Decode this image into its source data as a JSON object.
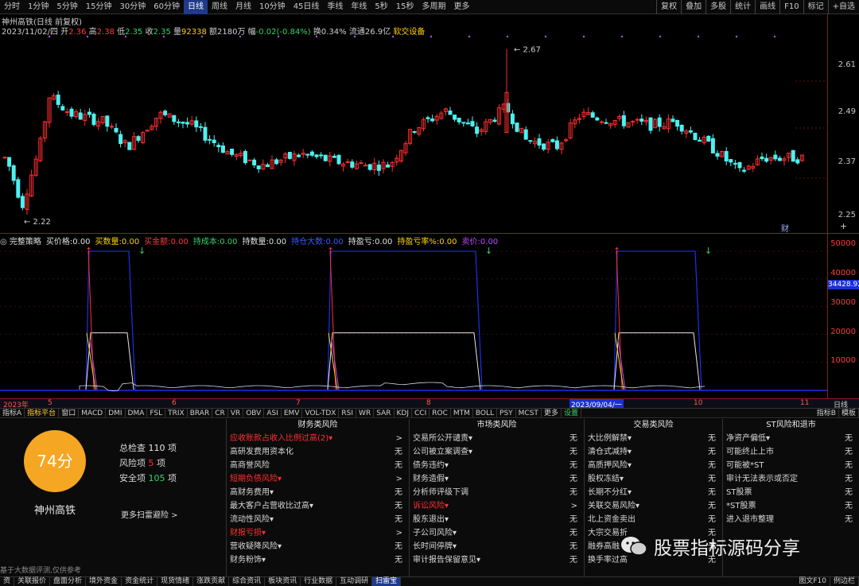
{
  "periods": [
    "分时",
    "1分钟",
    "5分钟",
    "15分钟",
    "30分钟",
    "60分钟",
    "日线",
    "周线",
    "月线",
    "10分钟",
    "45日线",
    "季线",
    "年线",
    "5秒",
    "15秒",
    "多周期",
    "更多"
  ],
  "selected_period": "日线",
  "top_right": [
    "复权",
    "叠加",
    "多股",
    "统计",
    "画线",
    "F10",
    "标记",
    "+自选"
  ],
  "stock_title": "神州高铁(日线 前复权)",
  "info_line2": {
    "date": "2023/11/02/四",
    "open_l": "开",
    "open": "2.36",
    "high_l": "高",
    "high": "2.38",
    "low_l": "低",
    "low": "2.35",
    "close_l": "收",
    "close": "2.35",
    "vol_l": "量",
    "vol": "92338",
    "amt_l": "额",
    "amt": "2180万",
    "chg_l": "幅",
    "chg": "-0.02(-0.84%)",
    "turn_l": "换",
    "turn": "0.34%",
    "float_l": "流通",
    "float": "26.9亿",
    "link": "软交设备"
  },
  "price_axis": [
    "2.61",
    "2.49",
    "2.37",
    "2.25"
  ],
  "max_label": "2.67",
  "min_label": "2.22",
  "fin_marker": "财",
  "indicator_header": {
    "name": "完整策略",
    "fields": [
      {
        "label": "买价格:",
        "value": "0.00",
        "color": "#e0e0e0"
      },
      {
        "label": "买数量:",
        "value": "0.00",
        "color": "#ffd400"
      },
      {
        "label": "买金额:",
        "value": "0.00",
        "color": "#ff3b3b"
      },
      {
        "label": "持成本:",
        "value": "0.00",
        "color": "#36d16a"
      },
      {
        "label": "持数量:",
        "value": "0.00",
        "color": "#e0e0e0"
      },
      {
        "label": "持仓大数:",
        "value": "0.00",
        "color": "#3a5bff"
      },
      {
        "label": "持盈亏:",
        "value": "0.00",
        "color": "#e0e0e0"
      },
      {
        "label": "持盈亏率%:",
        "value": "0.00",
        "color": "#ffd400"
      },
      {
        "label": "卖价:",
        "value": "0.00",
        "color": "#c048ff"
      }
    ]
  },
  "ind_axis": [
    "50000",
    "40000",
    "30000",
    "20000",
    "10000"
  ],
  "ind_current": "34428.92",
  "dates": {
    "year": "2023年",
    "m5": "5",
    "m6": "6",
    "m7": "7",
    "m8": "8",
    "sel": "2023/09/04/一",
    "m10": "10",
    "m11": "11",
    "day": "日线"
  },
  "tabs": [
    "指标A",
    "指标平台",
    "窗口",
    "MACD",
    "DMI",
    "DMA",
    "FSL",
    "TRIX",
    "BRAR",
    "CR",
    "VR",
    "OBV",
    "ASI",
    "EMV",
    "VOL-TDX",
    "RSI",
    "WR",
    "SAR",
    "KDJ",
    "CCI",
    "ROC",
    "MTM",
    "BOLL",
    "PSY",
    "MCST",
    "更多",
    "设置"
  ],
  "tabs_right": [
    "指标B",
    "模板"
  ],
  "risk": {
    "score": "74分",
    "name": "神州高铁",
    "total_l": "总检查",
    "total": "110",
    "total_u": "项",
    "risk_l": "风险项",
    "risk": "5",
    "risk_u": "项",
    "safe_l": "安全项",
    "safe": "105",
    "safe_u": "项",
    "more": "更多扫雷避险 >",
    "note": "基于大数据评测,仅供参考"
  },
  "columns": [
    {
      "title": "财务类风险",
      "items": [
        {
          "t": "应收账款占收入比例过高(2)▾",
          "s": ">",
          "red": true
        },
        {
          "t": "高研发费用资本化",
          "s": "无"
        },
        {
          "t": "高商誉风险",
          "s": "无"
        },
        {
          "t": "短期负债风险▾",
          "s": ">",
          "red": true
        },
        {
          "t": "高财务费用▾",
          "s": "无"
        },
        {
          "t": "最大客户占营收比过高▾",
          "s": "无"
        },
        {
          "t": "流动性风险▾",
          "s": "无"
        },
        {
          "t": "财报亏损▾",
          "s": ">",
          "red": true
        },
        {
          "t": "营收疑降风险▾",
          "s": "无"
        },
        {
          "t": "财务粉饰▾",
          "s": "无"
        }
      ]
    },
    {
      "title": "市场类风险",
      "items": [
        {
          "t": "交易所公开谴责▾",
          "s": "无"
        },
        {
          "t": "公司被立案调查▾",
          "s": "无"
        },
        {
          "t": "债务违约▾",
          "s": "无"
        },
        {
          "t": "财务造假▾",
          "s": "无"
        },
        {
          "t": "分析师评级下调",
          "s": "无"
        },
        {
          "t": "诉讼风险▾",
          "s": ">",
          "red": true
        },
        {
          "t": "股东退出▾",
          "s": "无"
        },
        {
          "t": "子公司风险▾",
          "s": "无"
        },
        {
          "t": "长时间停牌▾",
          "s": "无"
        },
        {
          "t": "审计报告保留意见▾",
          "s": "无"
        }
      ]
    },
    {
      "title": "交易类风险",
      "items": [
        {
          "t": "大比例解禁▾",
          "s": "无"
        },
        {
          "t": "清仓式减持▾",
          "s": "无"
        },
        {
          "t": "高质押风险▾",
          "s": "无"
        },
        {
          "t": "股权冻结▾",
          "s": "无"
        },
        {
          "t": "长期不分红▾",
          "s": "无"
        },
        {
          "t": "关联交易风险▾",
          "s": "无"
        },
        {
          "t": "北上资金卖出",
          "s": "无"
        },
        {
          "t": "大宗交易折",
          "s": "无"
        },
        {
          "t": "融券高融",
          "s": "无"
        },
        {
          "t": "换手率过高",
          "s": "无"
        }
      ]
    },
    {
      "title": "ST风险和退市",
      "items": [
        {
          "t": "净资产偏低▾",
          "s": "无"
        },
        {
          "t": "可能终止上市",
          "s": "无"
        },
        {
          "t": "可能被*ST",
          "s": "无"
        },
        {
          "t": "审计无法表示或否定",
          "s": "无"
        },
        {
          "t": "ST股票",
          "s": "无"
        },
        {
          "t": "*ST股票",
          "s": "无"
        },
        {
          "t": "进入退市整理",
          "s": "无"
        },
        {
          "t": "",
          "s": ""
        },
        {
          "t": "",
          "s": ""
        },
        {
          "t": "",
          "s": ""
        }
      ]
    }
  ],
  "watermark": "股票指标源码分享",
  "bottom_tabs": [
    "资",
    "关联报价",
    "盘面分析",
    "境外资金",
    "资金统计",
    "现货情绪",
    "涨跌贡献",
    "综合资讯",
    "板块资讯",
    "行业数据",
    "互动调研",
    "扫雷宝"
  ],
  "bottom_sel": "扫雷宝",
  "bottom_right": [
    "图文F10",
    "例边栏"
  ],
  "colors": {
    "up": "#ff2d2d",
    "down": "#4ef0f0",
    "axis": "#8a1f1f",
    "strategy_blue": "#1e2ef0",
    "strategy_white": "#e8e8e8",
    "strategy_red": "#ff3030",
    "strategy_yellow": "#ffd400"
  }
}
